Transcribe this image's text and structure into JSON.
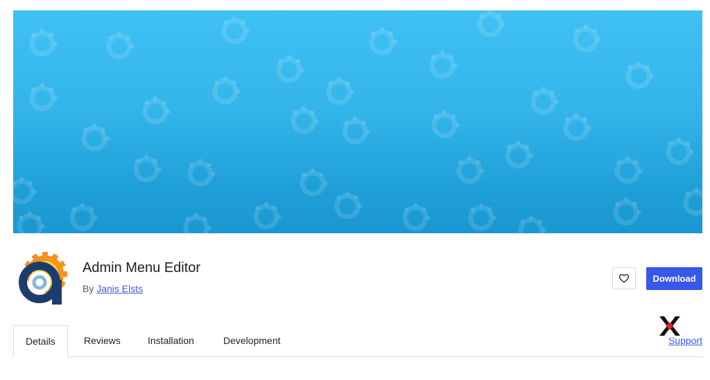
{
  "plugin": {
    "name": "Admin Menu Editor",
    "by_prefix": "By",
    "author": "Janis Elsts"
  },
  "actions": {
    "favorite_icon": "heart-outline-icon",
    "download_label": "Download"
  },
  "tabs": [
    {
      "label": "Details",
      "active": true
    },
    {
      "label": "Reviews",
      "active": false
    },
    {
      "label": "Installation",
      "active": false
    },
    {
      "label": "Development",
      "active": false
    }
  ],
  "support_link": "Support",
  "colors": {
    "banner_top": "#3fc1f4",
    "banner_bottom": "#1a97d2",
    "accent": "#3858e9",
    "icon_orange": "#f6921e",
    "icon_navy": "#1d3c6e"
  }
}
